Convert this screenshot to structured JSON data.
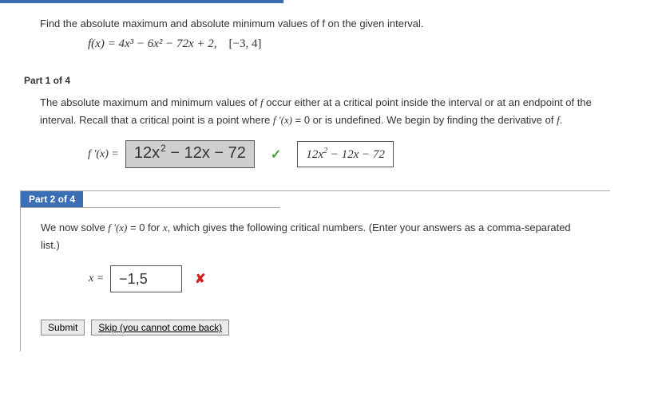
{
  "question": {
    "prompt": "Find the absolute maximum and absolute minimum values of f on the given interval.",
    "func_lhs": "f(x) = ",
    "func_rhs": "4x³ − 6x² − 72x + 2,",
    "interval": "[−3, 4]"
  },
  "part1": {
    "label": "Part 1 of 4",
    "text_a": "The absolute maximum and minimum values of ",
    "f1": "f",
    "text_b": " occur either at a critical point inside the interval or at an endpoint of the interval. Recall that a critical point is a point where ",
    "fprime": "f '(x)",
    "text_c": " = 0 or is undefined. We begin by finding the derivative of ",
    "f2": "f",
    "text_d": ".",
    "lhs": "f '(x) = ",
    "answer_term1": "12x",
    "answer_exp": "2",
    "answer_rest": "− 12x − 72",
    "preview": "12x² − 12x − 72"
  },
  "part2": {
    "label": "Part 2 of 4",
    "text_a": "We now solve ",
    "fprime": "f '(x)",
    "text_b": " = 0  for ",
    "xvar": "x",
    "text_c": ", which gives the following critical numbers. (Enter your answers as a comma-separated list.)",
    "lhs": "x = ",
    "input_value": "−1,5"
  },
  "buttons": {
    "submit": "Submit",
    "skip": "Skip (you cannot come back)"
  }
}
